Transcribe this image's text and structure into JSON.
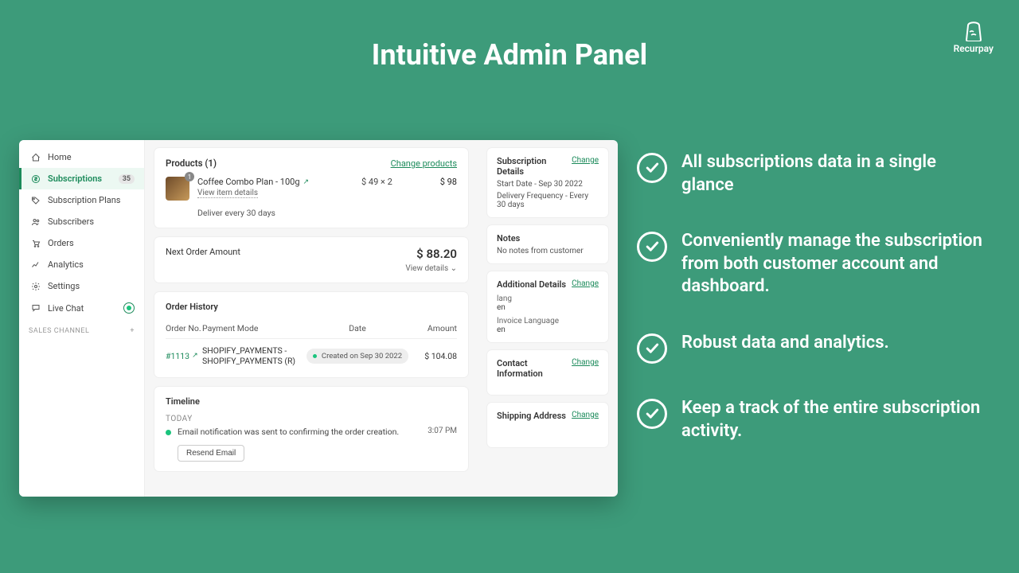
{
  "brand": "Recurpay",
  "page_heading": "Intuitive Admin Panel",
  "sidebar": {
    "items": [
      {
        "label": "Home"
      },
      {
        "label": "Subscriptions",
        "badge": "35"
      },
      {
        "label": "Subscription Plans"
      },
      {
        "label": "Subscribers"
      },
      {
        "label": "Orders"
      },
      {
        "label": "Analytics"
      },
      {
        "label": "Settings"
      },
      {
        "label": "Live Chat"
      }
    ],
    "section_label": "SALES CHANNEL"
  },
  "products_card": {
    "title": "Products (1)",
    "change": "Change products",
    "name": "Coffee Combo Plan - 100g",
    "view_details": "View item details",
    "deliver": "Deliver every 30 days",
    "price_each": "$ 49 × 2",
    "price_total": "$ 98"
  },
  "next_order": {
    "label": "Next Order Amount",
    "amount": "$ 88.20",
    "view": "View details ⌄"
  },
  "order_history": {
    "title": "Order History",
    "columns": {
      "order": "Order No.",
      "payment": "Payment Mode",
      "date": "Date",
      "amount": "Amount"
    },
    "row": {
      "order_no": "#1113",
      "payment": "SHOPIFY_PAYMENTS - SHOPIFY_PAYMENTS (R)",
      "date_pill": "Created on Sep 30 2022",
      "amount": "$ 104.08"
    }
  },
  "timeline": {
    "title": "Timeline",
    "today": "TODAY",
    "msg": "Email notification was sent to                       confirming the order creation.",
    "time": "3:07 PM",
    "resend": "Resend Email"
  },
  "sub_details": {
    "title": "Subscription Details",
    "change": "Change",
    "start": "Start Date - Sep 30 2022",
    "freq": "Delivery Frequency - Every 30 days"
  },
  "notes": {
    "title": "Notes",
    "body": "No notes from customer"
  },
  "additional": {
    "title": "Additional Details",
    "change": "Change",
    "k1": "lang",
    "v1": "en",
    "k2": "Invoice Language",
    "v2": "en"
  },
  "contact": {
    "title": "Contact Information",
    "change": "Change"
  },
  "shipping": {
    "title": "Shipping Address",
    "change": "Change"
  },
  "features": [
    "All subscriptions data in a single glance",
    "Conveniently manage the subscription from both customer account and dashboard.",
    "Robust data and analytics.",
    "Keep a track of the entire subscription activity."
  ]
}
